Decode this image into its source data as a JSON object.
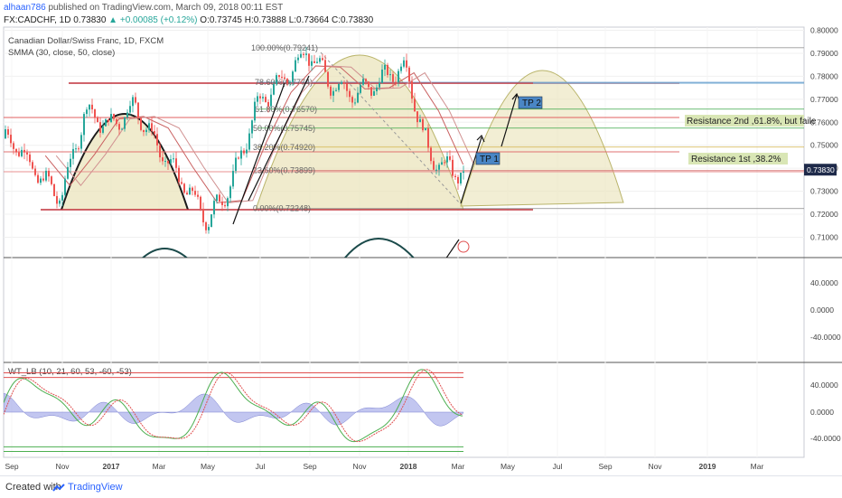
{
  "header": {
    "user": "alhaan786",
    "published_text": "published on TradingView.com, March 09, 2018 00:11 EST",
    "symbol": "FX:CADCHF, 1D",
    "last": "0.73830",
    "change": "+0.00085 (+0.12%)",
    "open": "O:0.73745",
    "high": "H:0.73888",
    "low": "L:0.73664",
    "close": "C:0.73830"
  },
  "legend": {
    "instrument": "Canadian Dollar/Swiss Franc, 1D, FXCM",
    "indicator": "SMMA (30, close, 50, close)",
    "oscillator": "WT_LB (10, 21, 60, 53, -60, -53)"
  },
  "footer": {
    "created_with": "Created with",
    "brand": "TradingView"
  },
  "colors": {
    "up": "#26a69a",
    "down": "#ef5350",
    "fib": "#888888",
    "dome_fill": "#e9e3b8",
    "accent": "#2962ff"
  },
  "chart_data": [
    {
      "type": "line",
      "title": "Canadian Dollar/Swiss Franc, 1D, FXCM",
      "x_ticks": [
        "Sep",
        "Nov",
        "2017",
        "Mar",
        "May",
        "Jul",
        "Sep",
        "Nov",
        "2018",
        "Mar",
        "May",
        "Jul",
        "Sep",
        "Nov",
        "2019",
        "Mar"
      ],
      "y_ticks": [
        "0.80000",
        "0.79000",
        "0.78000",
        "0.77000",
        "0.76000",
        "0.75000",
        "0.74000",
        "0.73000",
        "0.72000",
        "0.71000"
      ],
      "ylim": [
        0.706,
        0.8
      ],
      "last_price_label": "0.73830",
      "price_series": [
        {
          "x": "2016-09",
          "y": 0.753
        },
        {
          "x": "2016-10",
          "y": 0.738
        },
        {
          "x": "2016-11",
          "y": 0.727
        },
        {
          "x": "2016-12",
          "y": 0.765
        },
        {
          "x": "2017-01",
          "y": 0.758
        },
        {
          "x": "2017-02",
          "y": 0.767
        },
        {
          "x": "2017-03",
          "y": 0.748
        },
        {
          "x": "2017-04",
          "y": 0.733
        },
        {
          "x": "2017-05",
          "y": 0.717
        },
        {
          "x": "2017-06",
          "y": 0.735
        },
        {
          "x": "2017-07",
          "y": 0.768
        },
        {
          "x": "2017-08",
          "y": 0.778
        },
        {
          "x": "2017-09",
          "y": 0.791
        },
        {
          "x": "2017-10",
          "y": 0.777
        },
        {
          "x": "2017-11",
          "y": 0.772
        },
        {
          "x": "2017-12",
          "y": 0.778
        },
        {
          "x": "2018-01",
          "y": 0.785
        },
        {
          "x": "2018-02",
          "y": 0.745
        },
        {
          "x": "2018-03",
          "y": 0.7383
        }
      ],
      "fibonacci": [
        {
          "label": "100.00%(0.79241)",
          "value": 0.79241
        },
        {
          "label": "78.60%(0.7774)",
          "value": 0.7774
        },
        {
          "label": "61.80%(0.76570)",
          "value": 0.7657
        },
        {
          "label": "50.00%(0.75745)",
          "value": 0.75745
        },
        {
          "label": "38.20%(0.74920)",
          "value": 0.7492
        },
        {
          "label": "23.60%(0.73899)",
          "value": 0.73899
        },
        {
          "label": "0.00%(0.72248)",
          "value": 0.72248
        }
      ],
      "annotations": [
        "TP 1",
        "TP 2",
        "Resistance 2nd ,61.8%, but faile",
        "Resistance 1st ,38.2%"
      ]
    },
    {
      "type": "line",
      "title": "",
      "y_ticks": [
        "40.0000",
        "0.0000",
        "-40.0000"
      ]
    },
    {
      "type": "line",
      "title": "WT_LB (10, 21, 60, 53, -60, -53)",
      "y_ticks": [
        "40.0000",
        "0.0000",
        "-40.0000"
      ],
      "ylim": [
        -65,
        70
      ],
      "levels": [
        60,
        53,
        -60,
        -53
      ]
    }
  ]
}
